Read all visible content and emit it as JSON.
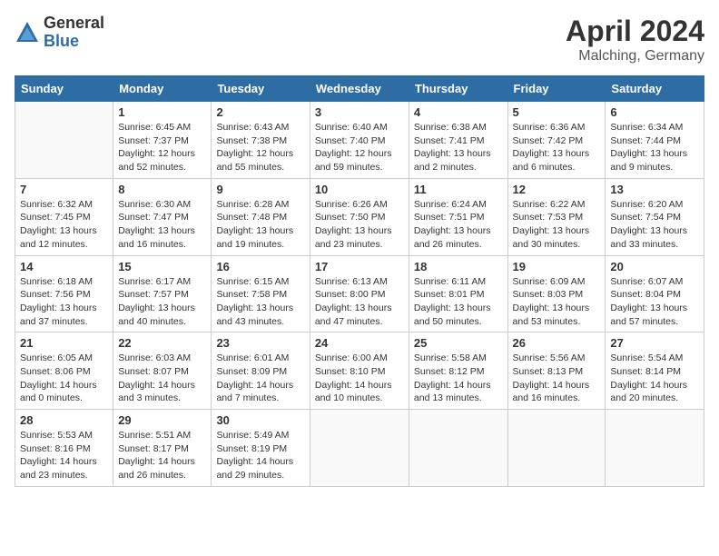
{
  "logo": {
    "general": "General",
    "blue": "Blue"
  },
  "title": {
    "month_year": "April 2024",
    "location": "Malching, Germany"
  },
  "weekdays": [
    "Sunday",
    "Monday",
    "Tuesday",
    "Wednesday",
    "Thursday",
    "Friday",
    "Saturday"
  ],
  "weeks": [
    [
      {
        "day": "",
        "sunrise": "",
        "sunset": "",
        "daylight": ""
      },
      {
        "day": "1",
        "sunrise": "Sunrise: 6:45 AM",
        "sunset": "Sunset: 7:37 PM",
        "daylight": "Daylight: 12 hours and 52 minutes."
      },
      {
        "day": "2",
        "sunrise": "Sunrise: 6:43 AM",
        "sunset": "Sunset: 7:38 PM",
        "daylight": "Daylight: 12 hours and 55 minutes."
      },
      {
        "day": "3",
        "sunrise": "Sunrise: 6:40 AM",
        "sunset": "Sunset: 7:40 PM",
        "daylight": "Daylight: 12 hours and 59 minutes."
      },
      {
        "day": "4",
        "sunrise": "Sunrise: 6:38 AM",
        "sunset": "Sunset: 7:41 PM",
        "daylight": "Daylight: 13 hours and 2 minutes."
      },
      {
        "day": "5",
        "sunrise": "Sunrise: 6:36 AM",
        "sunset": "Sunset: 7:42 PM",
        "daylight": "Daylight: 13 hours and 6 minutes."
      },
      {
        "day": "6",
        "sunrise": "Sunrise: 6:34 AM",
        "sunset": "Sunset: 7:44 PM",
        "daylight": "Daylight: 13 hours and 9 minutes."
      }
    ],
    [
      {
        "day": "7",
        "sunrise": "Sunrise: 6:32 AM",
        "sunset": "Sunset: 7:45 PM",
        "daylight": "Daylight: 13 hours and 12 minutes."
      },
      {
        "day": "8",
        "sunrise": "Sunrise: 6:30 AM",
        "sunset": "Sunset: 7:47 PM",
        "daylight": "Daylight: 13 hours and 16 minutes."
      },
      {
        "day": "9",
        "sunrise": "Sunrise: 6:28 AM",
        "sunset": "Sunset: 7:48 PM",
        "daylight": "Daylight: 13 hours and 19 minutes."
      },
      {
        "day": "10",
        "sunrise": "Sunrise: 6:26 AM",
        "sunset": "Sunset: 7:50 PM",
        "daylight": "Daylight: 13 hours and 23 minutes."
      },
      {
        "day": "11",
        "sunrise": "Sunrise: 6:24 AM",
        "sunset": "Sunset: 7:51 PM",
        "daylight": "Daylight: 13 hours and 26 minutes."
      },
      {
        "day": "12",
        "sunrise": "Sunrise: 6:22 AM",
        "sunset": "Sunset: 7:53 PM",
        "daylight": "Daylight: 13 hours and 30 minutes."
      },
      {
        "day": "13",
        "sunrise": "Sunrise: 6:20 AM",
        "sunset": "Sunset: 7:54 PM",
        "daylight": "Daylight: 13 hours and 33 minutes."
      }
    ],
    [
      {
        "day": "14",
        "sunrise": "Sunrise: 6:18 AM",
        "sunset": "Sunset: 7:56 PM",
        "daylight": "Daylight: 13 hours and 37 minutes."
      },
      {
        "day": "15",
        "sunrise": "Sunrise: 6:17 AM",
        "sunset": "Sunset: 7:57 PM",
        "daylight": "Daylight: 13 hours and 40 minutes."
      },
      {
        "day": "16",
        "sunrise": "Sunrise: 6:15 AM",
        "sunset": "Sunset: 7:58 PM",
        "daylight": "Daylight: 13 hours and 43 minutes."
      },
      {
        "day": "17",
        "sunrise": "Sunrise: 6:13 AM",
        "sunset": "Sunset: 8:00 PM",
        "daylight": "Daylight: 13 hours and 47 minutes."
      },
      {
        "day": "18",
        "sunrise": "Sunrise: 6:11 AM",
        "sunset": "Sunset: 8:01 PM",
        "daylight": "Daylight: 13 hours and 50 minutes."
      },
      {
        "day": "19",
        "sunrise": "Sunrise: 6:09 AM",
        "sunset": "Sunset: 8:03 PM",
        "daylight": "Daylight: 13 hours and 53 minutes."
      },
      {
        "day": "20",
        "sunrise": "Sunrise: 6:07 AM",
        "sunset": "Sunset: 8:04 PM",
        "daylight": "Daylight: 13 hours and 57 minutes."
      }
    ],
    [
      {
        "day": "21",
        "sunrise": "Sunrise: 6:05 AM",
        "sunset": "Sunset: 8:06 PM",
        "daylight": "Daylight: 14 hours and 0 minutes."
      },
      {
        "day": "22",
        "sunrise": "Sunrise: 6:03 AM",
        "sunset": "Sunset: 8:07 PM",
        "daylight": "Daylight: 14 hours and 3 minutes."
      },
      {
        "day": "23",
        "sunrise": "Sunrise: 6:01 AM",
        "sunset": "Sunset: 8:09 PM",
        "daylight": "Daylight: 14 hours and 7 minutes."
      },
      {
        "day": "24",
        "sunrise": "Sunrise: 6:00 AM",
        "sunset": "Sunset: 8:10 PM",
        "daylight": "Daylight: 14 hours and 10 minutes."
      },
      {
        "day": "25",
        "sunrise": "Sunrise: 5:58 AM",
        "sunset": "Sunset: 8:12 PM",
        "daylight": "Daylight: 14 hours and 13 minutes."
      },
      {
        "day": "26",
        "sunrise": "Sunrise: 5:56 AM",
        "sunset": "Sunset: 8:13 PM",
        "daylight": "Daylight: 14 hours and 16 minutes."
      },
      {
        "day": "27",
        "sunrise": "Sunrise: 5:54 AM",
        "sunset": "Sunset: 8:14 PM",
        "daylight": "Daylight: 14 hours and 20 minutes."
      }
    ],
    [
      {
        "day": "28",
        "sunrise": "Sunrise: 5:53 AM",
        "sunset": "Sunset: 8:16 PM",
        "daylight": "Daylight: 14 hours and 23 minutes."
      },
      {
        "day": "29",
        "sunrise": "Sunrise: 5:51 AM",
        "sunset": "Sunset: 8:17 PM",
        "daylight": "Daylight: 14 hours and 26 minutes."
      },
      {
        "day": "30",
        "sunrise": "Sunrise: 5:49 AM",
        "sunset": "Sunset: 8:19 PM",
        "daylight": "Daylight: 14 hours and 29 minutes."
      },
      {
        "day": "",
        "sunrise": "",
        "sunset": "",
        "daylight": ""
      },
      {
        "day": "",
        "sunrise": "",
        "sunset": "",
        "daylight": ""
      },
      {
        "day": "",
        "sunrise": "",
        "sunset": "",
        "daylight": ""
      },
      {
        "day": "",
        "sunrise": "",
        "sunset": "",
        "daylight": ""
      }
    ]
  ]
}
